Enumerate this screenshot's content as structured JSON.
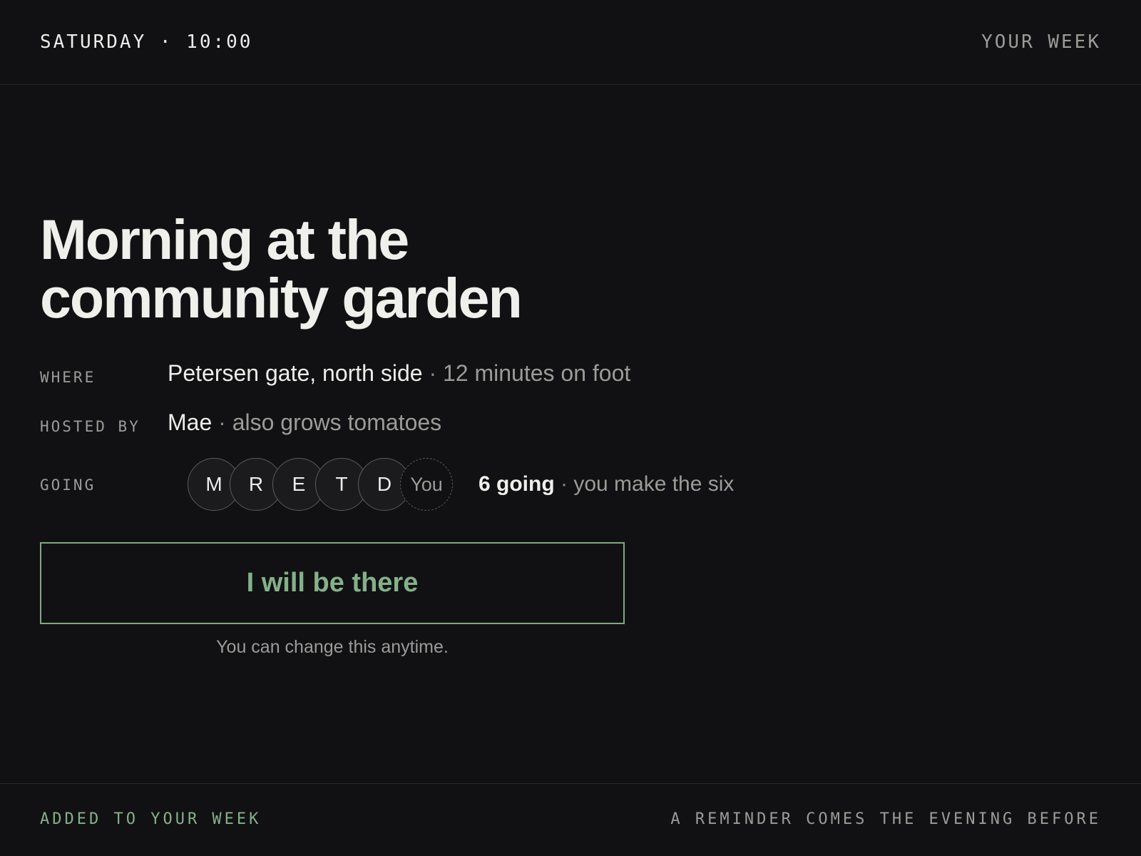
{
  "header": {
    "datetime": "SATURDAY · 10:00",
    "nav_label": "YOUR WEEK"
  },
  "event": {
    "title_line1": "Morning at the",
    "title_line2": "community garden"
  },
  "details": {
    "where": {
      "label": "WHERE",
      "place": "Petersen gate, north side",
      "separator": " · ",
      "extra": "12 minutes on foot"
    },
    "host": {
      "label": "HOSTED BY",
      "name": "Mae",
      "separator": " · ",
      "extra": "also grows tomatoes"
    },
    "going": {
      "label": "GOING",
      "avatars": [
        "M",
        "R",
        "E",
        "T",
        "D"
      ],
      "you_label": "You",
      "count_text": "6 going",
      "separator": " · ",
      "extra": "you make the six"
    }
  },
  "cta": {
    "label": "I will be there",
    "hint": "You can change this anytime."
  },
  "footer": {
    "status": "ADDED TO YOUR WEEK",
    "reminder": "A REMINDER COMES THE EVENING BEFORE"
  },
  "colors": {
    "background": "#111113",
    "accent_green": "#84b08a",
    "text_primary": "#ededea",
    "text_muted": "#9b9b98"
  }
}
